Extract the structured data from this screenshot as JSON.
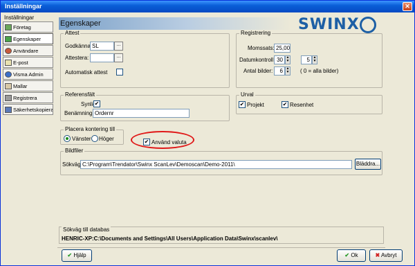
{
  "window": {
    "title": "Inställningar",
    "close_glyph": "✕"
  },
  "sidebar": {
    "header": "Inställningar",
    "items": [
      {
        "label": "Företag",
        "icon": "notebook-icon"
      },
      {
        "label": "Egenskaper",
        "icon": "settings-icon"
      },
      {
        "label": "Användare",
        "icon": "users-icon"
      },
      {
        "label": "E-post",
        "icon": "mail-icon"
      },
      {
        "label": "Visma Admin",
        "icon": "visma-icon"
      },
      {
        "label": "Mallar",
        "icon": "template-icon"
      },
      {
        "label": "Registrera",
        "icon": "register-icon"
      },
      {
        "label": "Säkerhetskopiera",
        "icon": "backup-icon"
      }
    ]
  },
  "page": {
    "title": "Egenskaper",
    "logo_text": "SWINX"
  },
  "attest": {
    "legend": "Attest",
    "godkanna_label": "Godkänna:",
    "godkanna_value": "SL",
    "attestera_label": "Attestera:",
    "attestera_value": "",
    "browse_glyph": "...",
    "auto_label": "Automatisk attest",
    "auto_checked": false
  },
  "registrering": {
    "legend": "Registrering",
    "moms_label": "Momssats:",
    "moms_value": "25,00",
    "datum_label": "Datumkontroll:",
    "datum_value1": "30",
    "datum_value2": "5",
    "antal_label": "Antal bilder:",
    "antal_value": "6",
    "antal_hint": "( 0 = alla bilder)"
  },
  "referensfalt": {
    "legend": "Referensfält",
    "synligt_label": "Synligt:",
    "synligt_checked": true,
    "benamning_label": "Benämning:",
    "benamning_value": "Ordernr"
  },
  "urval": {
    "legend": "Urval",
    "projekt_label": "Projekt",
    "projekt_checked": true,
    "resenhet_label": "Resenhet",
    "resenhet_checked": true
  },
  "kontering": {
    "legend": "Placera kontering till",
    "vanster_label": "Vänster",
    "hoger_label": "Höger",
    "selected": "Vänster"
  },
  "valuta": {
    "label": "Använd valuta",
    "checked": true
  },
  "bildfiler": {
    "legend": "Bildfiler",
    "sokvag_label": "Sökväg:",
    "sokvag_value": "C:\\Program\\Trendator\\Swinx ScanLev\\Demoscan\\Demo-2011\\",
    "browse_label": "Bläddra..."
  },
  "databas": {
    "legend": "Sökväg till databas",
    "path": "HENRIC-XP:C:\\Documents and Settings\\All Users\\Application Data\\Swinx\\scanlev\\"
  },
  "footer": {
    "help_label": "Hjälp",
    "ok_label": "Ok",
    "cancel_label": "Avbryt"
  },
  "check_glyph": "✔",
  "colors": {
    "titlebar": "#0a5fd8",
    "highlight": "#e01818",
    "logo": "#1d5fa5"
  }
}
